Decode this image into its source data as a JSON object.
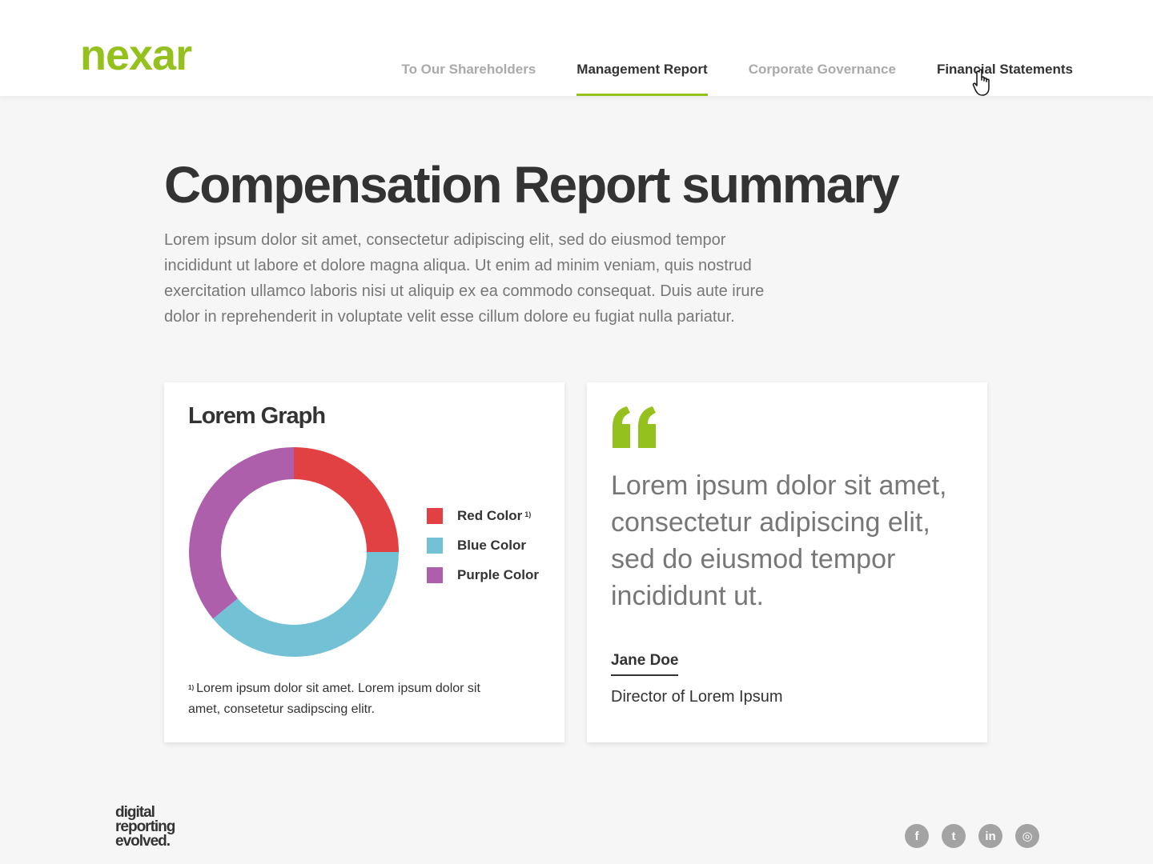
{
  "header": {
    "logo_text": "nexar",
    "nav": [
      {
        "label": "To Our Shareholders",
        "state": "inactive"
      },
      {
        "label": "Management Report",
        "state": "active"
      },
      {
        "label": "Corporate Governance",
        "state": "inactive"
      },
      {
        "label": "Financial Statements",
        "state": "hover"
      }
    ],
    "brand_color": "#95c11f"
  },
  "main": {
    "title": "Compensation Report summary",
    "intro": "Lorem ipsum dolor sit amet, consectetur adipiscing elit, sed do eiusmod tempor incididunt ut labore et dolore magna aliqua. Ut enim ad minim veniam, quis nostrud exercitation ullamco laboris nisi ut aliquip ex ea commodo consequat. Duis aute irure dolor in reprehenderit in voluptate velit esse cillum dolore eu fugiat nulla pariatur."
  },
  "graph_card": {
    "title": "Lorem Graph",
    "legend": [
      {
        "label": "Red Color",
        "sup": "1)",
        "color": "#e24144"
      },
      {
        "label": "Blue Color",
        "sup": "",
        "color": "#72c1d4"
      },
      {
        "label": "Purple Color",
        "sup": "",
        "color": "#ad5fab"
      }
    ],
    "footnote_marker": "1)",
    "footnote": "Lorem ipsum dolor sit amet. Lorem ipsum dolor sit amet, consetetur sadipscing elitr."
  },
  "chart_data": {
    "type": "pie",
    "style": "donut",
    "categories": [
      "Red Color",
      "Blue Color",
      "Purple Color"
    ],
    "values": [
      25,
      39,
      36
    ],
    "colors": [
      "#e24144",
      "#72c1d4",
      "#ad5fab"
    ]
  },
  "quote_card": {
    "quote_icon": "quote-icon",
    "quote": "Lorem ipsum dolor sit amet, consectetur adipiscing elit, sed do eiusmod tempor incididunt ut.",
    "author": "Jane Doe",
    "role": "Director of Lorem Ipsum"
  },
  "footer": {
    "tagline_lines": [
      "digital",
      "reporting",
      "evolved."
    ],
    "socials": [
      {
        "icon": "facebook-icon",
        "glyph": "f"
      },
      {
        "icon": "twitter-icon",
        "glyph": "t"
      },
      {
        "icon": "linkedin-icon",
        "glyph": "in"
      },
      {
        "icon": "instagram-icon",
        "glyph": "◎"
      }
    ]
  }
}
